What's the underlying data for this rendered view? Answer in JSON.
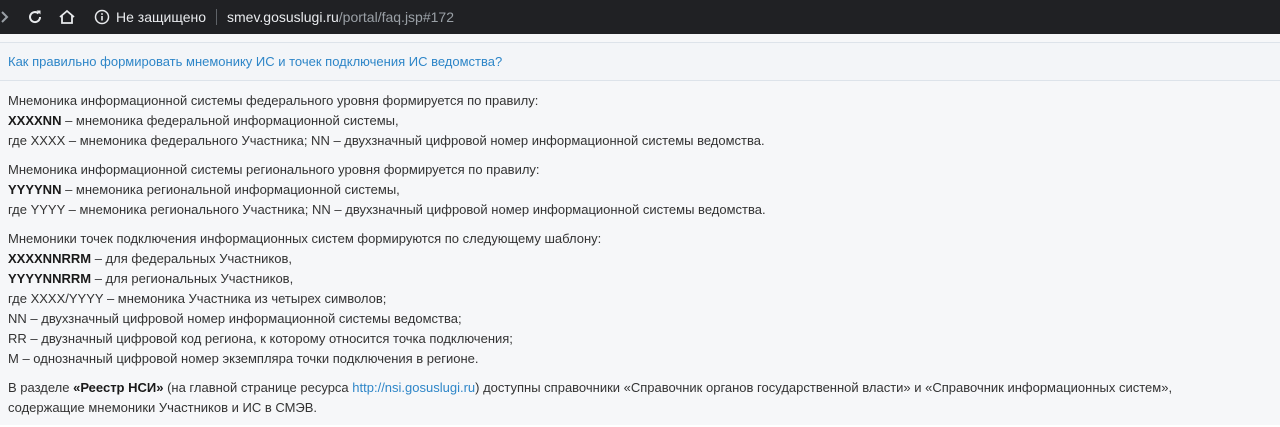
{
  "browser": {
    "security_label": "Не защищено",
    "url_host": "smev.gosuslugi.ru",
    "url_path": "/portal/faq.jsp#172"
  },
  "faq": {
    "question": "Как правильно формировать мнемонику ИС и точек подключения ИС ведомства?",
    "p1": {
      "intro": "Мнемоника информационной системы федерального уровня формируется по правилу:",
      "code": "XXXXNN",
      "code_desc": " – мнемоника федеральной информационной системы,",
      "where": "где XXXX – мнемоника федерального Участника; NN – двухзначный цифровой номер информационной системы ведомства."
    },
    "p2": {
      "intro": "Мнемоника информационной системы регионального уровня формируется по правилу:",
      "code": "YYYYNN",
      "code_desc": " – мнемоника региональной информационной системы,",
      "where": "где YYYY – мнемоника регионального Участника; NN – двухзначный цифровой номер информационной системы ведомства."
    },
    "p3": {
      "intro": "Мнемоники точек подключения информационных систем формируются по следующему шаблону:",
      "code1": "XXXXNNRRM",
      "code1_desc": " – для федеральных Участников,",
      "code2": "YYYYNNRRM",
      "code2_desc": " – для региональных Участников,",
      "l1": "где XXXX/YYYY – мнемоника Участника из четырех символов;",
      "l2": "NN – двухзначный цифровой номер информационной системы ведомства;",
      "l3": "RR – двузначный цифровой код региона, к которому относится точка подключения;",
      "l4": "M – однозначный цифровой номер экземпляра точки подключения в регионе."
    },
    "p4": {
      "t1": "В разделе ",
      "bold": "«Реестр НСИ»",
      "t2": " (на главной странице ресурса ",
      "link": "http://nsi.gosuslugi.ru",
      "t3": ") доступны справочники «Справочник органов государственной власти» и «Справочник информационных систем»,",
      "t4": "содержащие мнемоники Участников и ИС в СМЭВ."
    }
  }
}
